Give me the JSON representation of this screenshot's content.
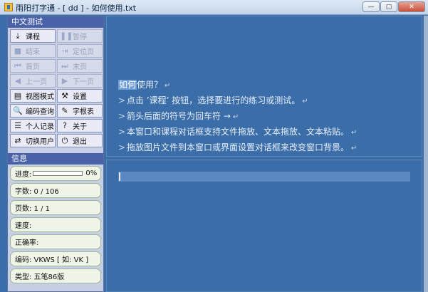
{
  "window": {
    "title": "雨阳打字通 - [ dd ] - 如何使用.txt",
    "btn_minimize": "—",
    "btn_maximize": "▢",
    "btn_close": "✕"
  },
  "tools": {
    "header": "中文测试",
    "buttons": [
      {
        "label": "课程",
        "icon": "download-icon",
        "glyph": "⤓",
        "enabled": true
      },
      {
        "label": "暂停",
        "icon": "pause-icon",
        "glyph": "❚❚",
        "enabled": false
      },
      {
        "label": "结束",
        "icon": "stop-icon",
        "glyph": "■",
        "enabled": false
      },
      {
        "label": "定位页",
        "icon": "locate-page-icon",
        "glyph": "⇥",
        "enabled": false
      },
      {
        "label": "首页",
        "icon": "first-page-icon",
        "glyph": "⏮",
        "enabled": false
      },
      {
        "label": "末页",
        "icon": "last-page-icon",
        "glyph": "⏭",
        "enabled": false
      },
      {
        "label": "上一页",
        "icon": "prev-page-icon",
        "glyph": "◀",
        "enabled": false
      },
      {
        "label": "下一页",
        "icon": "next-page-icon",
        "glyph": "▶",
        "enabled": false
      },
      {
        "label": "视图模式",
        "icon": "view-mode-icon",
        "glyph": "▤",
        "enabled": true
      },
      {
        "label": "设置",
        "icon": "hammer-icon",
        "glyph": "⚒",
        "enabled": true
      },
      {
        "label": "编码查询",
        "icon": "search-icon",
        "glyph": "🔍",
        "enabled": true
      },
      {
        "label": "字根表",
        "icon": "pen-icon",
        "glyph": "✎",
        "enabled": true
      },
      {
        "label": "个人记录",
        "icon": "list-icon",
        "glyph": "☰",
        "enabled": true
      },
      {
        "label": "关于",
        "icon": "question-icon",
        "glyph": "?",
        "enabled": true
      },
      {
        "label": "切换用户",
        "icon": "switch-user-icon",
        "glyph": "⇄",
        "enabled": true
      },
      {
        "label": "退出",
        "icon": "power-icon",
        "glyph": "⏻",
        "enabled": true
      }
    ]
  },
  "info": {
    "header": "信息",
    "progress_label": "进度:",
    "progress_value": 0,
    "progress_text": "0%",
    "chars": "字数: 0 / 106",
    "pages": "页数: 1 / 1",
    "speed": "速度:",
    "accuracy": "正确率:",
    "encoding": "编码: VKWS [ 如: VK ]",
    "type": "类型: 五笔86版"
  },
  "content": {
    "q_highlight": "如何",
    "q_rest": "使用？",
    "arrow": ">",
    "ret_mark": "↵",
    "lines": [
      "点击 ’课程’ 按钮，选择要进行的练习或测试。",
      "箭头后面的符号为回车符 →",
      "本窗口和课程对话框支持文件拖放、文本拖放、文本粘贴。",
      "拖放图片文件到本窗口或界面设置对话框来改变窗口背景。"
    ]
  }
}
